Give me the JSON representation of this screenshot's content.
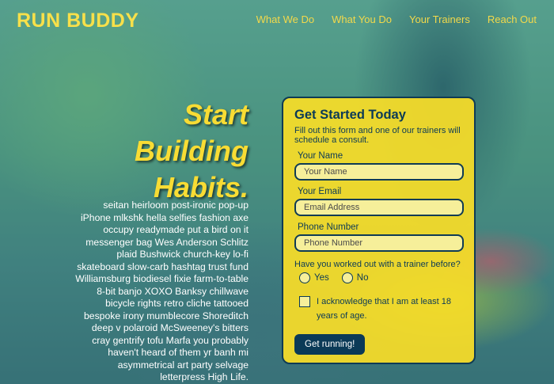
{
  "brand": "RUN BUDDY",
  "nav": {
    "items": [
      "What We Do",
      "What You Do",
      "Your Trainers",
      "Reach Out"
    ]
  },
  "hero": {
    "headline_lines": [
      "Start",
      "Building",
      "Habits."
    ],
    "body": "seitan heirloom post-ironic pop-up iPhone mlkshk hella selfies fashion axe occupy readymade put a bird on it messenger bag Wes Anderson Schlitz plaid Bushwick church-key lo-fi skateboard slow-carb hashtag trust fund Williamsburg biodiesel fixie farm-to-table 8-bit banjo XOXO Banksy chillwave bicycle rights retro cliche tattooed bespoke irony mumblecore Shoreditch deep v polaroid McSweeney's bitters cray gentrify tofu Marfa you probably haven't heard of them yr banh mi asymmetrical art party selvage letterpress High Life."
  },
  "form": {
    "title": "Get Started Today",
    "subtitle": "Fill out this form and one of our trainers will schedule a consult.",
    "name_label": "Your Name",
    "name_placeholder": "Your Name",
    "email_label": "Your Email",
    "email_placeholder": "Email Address",
    "phone_label": "Phone Number",
    "phone_placeholder": "Phone Number",
    "question": "Have you worked out with a trainer before?",
    "yes": "Yes",
    "no": "No",
    "ack": "I acknowledge that I am at least 18 years of age.",
    "submit": "Get running!"
  },
  "colors": {
    "accent": "#f8dc34",
    "dark": "#0b3a57"
  }
}
